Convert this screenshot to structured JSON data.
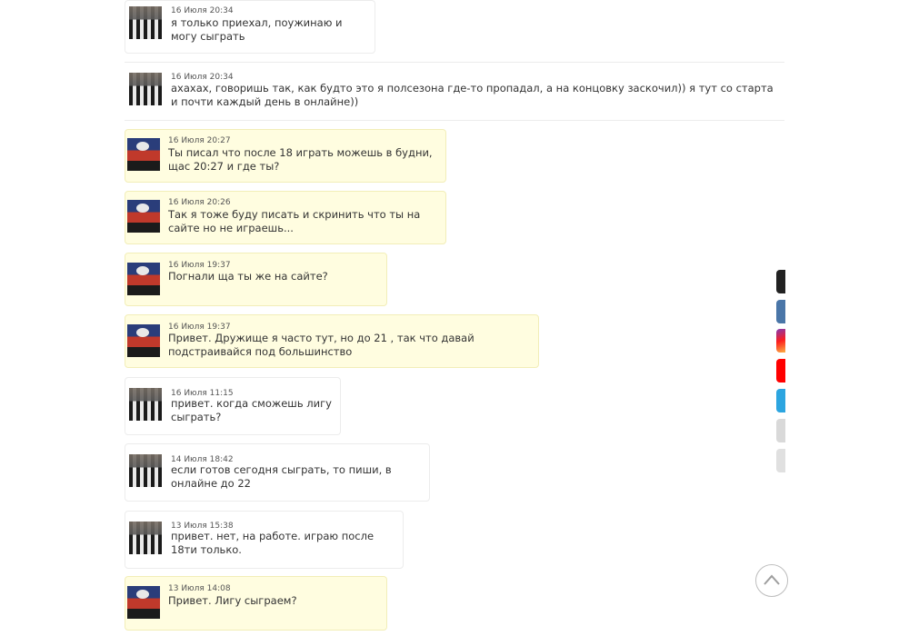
{
  "messages": [
    {
      "avatar": "user",
      "date": "16 Июля 20:34",
      "text": "я только приехал, поужинаю и могу сыграть"
    },
    {
      "avatar": "user",
      "date": "16 Июля 20:34",
      "text": "ахахах, говоришь так, как будто это я полсезона где-то пропадал, а на концовку заскочил)) я тут со старта и почти каждый день в онлайне))"
    },
    {
      "avatar": "mine",
      "date": "16 Июля 20:27",
      "text": "Ты писал что после 18 играть можешь в будни, щас 20:27 и где ты?"
    },
    {
      "avatar": "mine",
      "date": "16 Июля 20:26",
      "text": "Так я тоже буду писать и скринить что ты на сайте но не играешь..."
    },
    {
      "avatar": "mine",
      "date": "16 Июля 19:37",
      "text": "Погнали ща ты же на сайте?"
    },
    {
      "avatar": "mine",
      "date": "16 Июля 19:37",
      "text": "Привет. Дружище я часто тут, но до 21 , так что давай подстраивайся под большинство"
    },
    {
      "avatar": "user",
      "date": "16 Июля 11:15",
      "text": "привет. когда сможешь лигу сыграть?"
    },
    {
      "avatar": "user",
      "date": "14 Июля 18:42",
      "text": "если готов сегодня сыграть, то пиши, в онлайне до 22"
    },
    {
      "avatar": "user",
      "date": "13 Июля 15:38",
      "text": "привет. нет, на работе. играю после 18ти только."
    },
    {
      "avatar": "mine",
      "date": "13 Июля 14:08",
      "text": "Привет. Лигу сыграем?"
    }
  ],
  "social_links": [
    {
      "icon": "profile-icon",
      "color": "#222222"
    },
    {
      "icon": "vk-icon",
      "color": "#4a76a8"
    },
    {
      "icon": "instagram-icon",
      "color": "#c13584"
    },
    {
      "icon": "youtube-icon",
      "color": "#ff0000"
    },
    {
      "icon": "telegram-icon",
      "color": "#2ca5e0"
    },
    {
      "icon": "soccer-ball-icon",
      "color": "#d9d9d9"
    },
    {
      "icon": "extra-link-icon",
      "color": "#e0e0e0"
    }
  ],
  "colors": {
    "mine_bubble": "#fffde0",
    "other_bubble": "#ffffff",
    "border": "#ececec"
  }
}
